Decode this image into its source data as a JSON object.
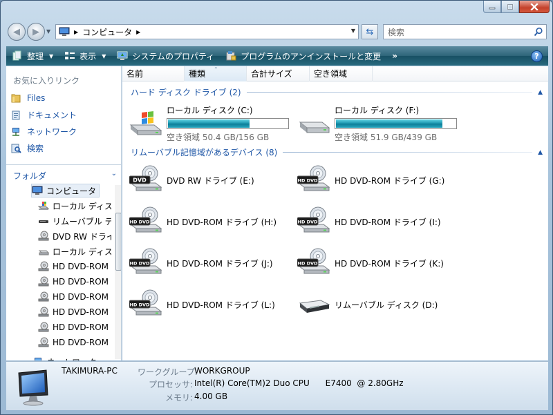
{
  "window": {
    "address": {
      "segment": "コンピュータ"
    },
    "search": {
      "placeholder": "検索"
    }
  },
  "toolbar": {
    "organize": "整理",
    "views": "表示",
    "system_properties": "システムのプロパティ",
    "uninstall": "プログラムのアンインストールと変更",
    "more": "»",
    "help": "?"
  },
  "favorites": {
    "title": "お気に入りリンク",
    "items": [
      "Files",
      "ドキュメント",
      "ネットワーク",
      "検索"
    ]
  },
  "folders": {
    "title": "フォルダ",
    "tree": [
      {
        "label": "コンピュータ",
        "icon": "computer-icon"
      },
      {
        "label": "ローカル ディスク",
        "icon": "windows-drive-icon"
      },
      {
        "label": "リムーバブル ディスク",
        "icon": "removable-drive-icon"
      },
      {
        "label": "DVD RW ドライブ",
        "icon": "dvd-drive-icon"
      },
      {
        "label": "ローカル ディスク",
        "icon": "hard-drive-icon"
      },
      {
        "label": "HD DVD-ROM",
        "icon": "dvd-drive-icon"
      },
      {
        "label": "HD DVD-ROM",
        "icon": "dvd-drive-icon"
      },
      {
        "label": "HD DVD-ROM",
        "icon": "dvd-drive-icon"
      },
      {
        "label": "HD DVD-ROM",
        "icon": "dvd-drive-icon"
      },
      {
        "label": "HD DVD-ROM",
        "icon": "dvd-drive-icon"
      },
      {
        "label": "HD DVD-ROM",
        "icon": "dvd-drive-icon"
      },
      {
        "label": "ネットワーク",
        "icon": "network-icon"
      }
    ]
  },
  "columns": [
    "名前",
    "種類",
    "合計サイズ",
    "空き領域"
  ],
  "groups": {
    "hdd": "ハード ディスク ドライブ (2)",
    "removable": "リムーバブル記憶域があるデバイス (8)"
  },
  "hard_drives": [
    {
      "name": "ローカル ディスク (C:)",
      "free_text": "空き領域 50.4 GB/156 GB",
      "used_fraction": 0.677
    },
    {
      "name": "ローカル ディスク (F:)",
      "free_text": "空き領域 51.9 GB/439 GB",
      "used_fraction": 0.882
    }
  ],
  "removable_drives": [
    {
      "name": "DVD RW ドライブ (E:)",
      "badge": "DVD"
    },
    {
      "name": "HD DVD-ROM ドライブ (G:)",
      "badge": "HD DVD"
    },
    {
      "name": "HD DVD-ROM ドライブ (H:)",
      "badge": "HD DVD"
    },
    {
      "name": "HD DVD-ROM ドライブ (I:)",
      "badge": "HD DVD"
    },
    {
      "name": "HD DVD-ROM ドライブ (J:)",
      "badge": "HD DVD"
    },
    {
      "name": "HD DVD-ROM ドライブ (K:)",
      "badge": "HD DVD"
    },
    {
      "name": "HD DVD-ROM ドライブ (L:)",
      "badge": "HD DVD"
    },
    {
      "name": "リムーバブル ディスク (D:)",
      "badge": ""
    }
  ],
  "details": {
    "computer_name": "TAKIMURA-PC",
    "workgroup_label": "ワークグループ:",
    "workgroup": "WORKGROUP",
    "processor_label": "プロセッサ:",
    "processor": "Intel(R) Core(TM)2 Duo CPU      E7400  @ 2.80GHz",
    "memory_label": "メモリ:",
    "memory": "4.00 GB"
  },
  "colors": {
    "link_blue": "#1e56a6",
    "toolbar_dark": "#174f63",
    "bar_fill": "#1893ad"
  }
}
